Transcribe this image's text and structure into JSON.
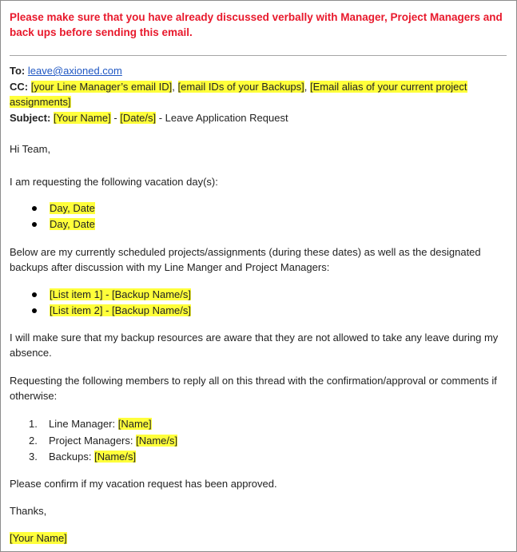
{
  "warning": "Please make sure that you have already discussed verbally with Manager, Project Managers and back ups before sending this email.",
  "header": {
    "to_label": "To:",
    "to_value": "leave@axioned.com",
    "cc_label": "CC:",
    "cc_1": "[your Line Manager’s email ID]",
    "cc_2": "[email IDs of your Backups]",
    "cc_3a": "[Email alias of your current project",
    "cc_3b": "assignments]",
    "subject_label": "Subject:",
    "subject_name": "[Your Name]",
    "subject_dates": "[Date/s]",
    "subject_rest": "- Leave Application Request"
  },
  "body": {
    "greeting": "Hi Team,",
    "request_intro": "I am requesting the following vacation day(s):",
    "days": [
      "Day, Date",
      "Day, Date"
    ],
    "projects_intro": "Below are my currently scheduled projects/assignments (during these dates) as well as the designated backups after discussion with my Line Manger and Project Managers:",
    "projects": [
      "[List item 1] - [Backup Name/s]",
      "[List item 2] - [Backup Name/s]"
    ],
    "backup_note": "I will make sure that my backup resources are aware that they are not allowed to take any leave during my absence.",
    "members_intro": "Requesting the following members to reply all on this thread with the confirmation/approval or comments if otherwise:",
    "members": [
      {
        "num": "1.",
        "label": "Line Manager:",
        "value": "[Name]"
      },
      {
        "num": "2.",
        "label": "Project Managers:",
        "value": "[Name/s]"
      },
      {
        "num": "3.",
        "label": "Backups:",
        "value": "[Name/s]"
      }
    ],
    "confirm": "Please confirm if my vacation request has been approved.",
    "thanks": "Thanks,",
    "signature": "[Your Name]"
  },
  "colors": {
    "warning": "#e8192c",
    "highlight": "#ffff3b",
    "link": "#1f57c3"
  }
}
